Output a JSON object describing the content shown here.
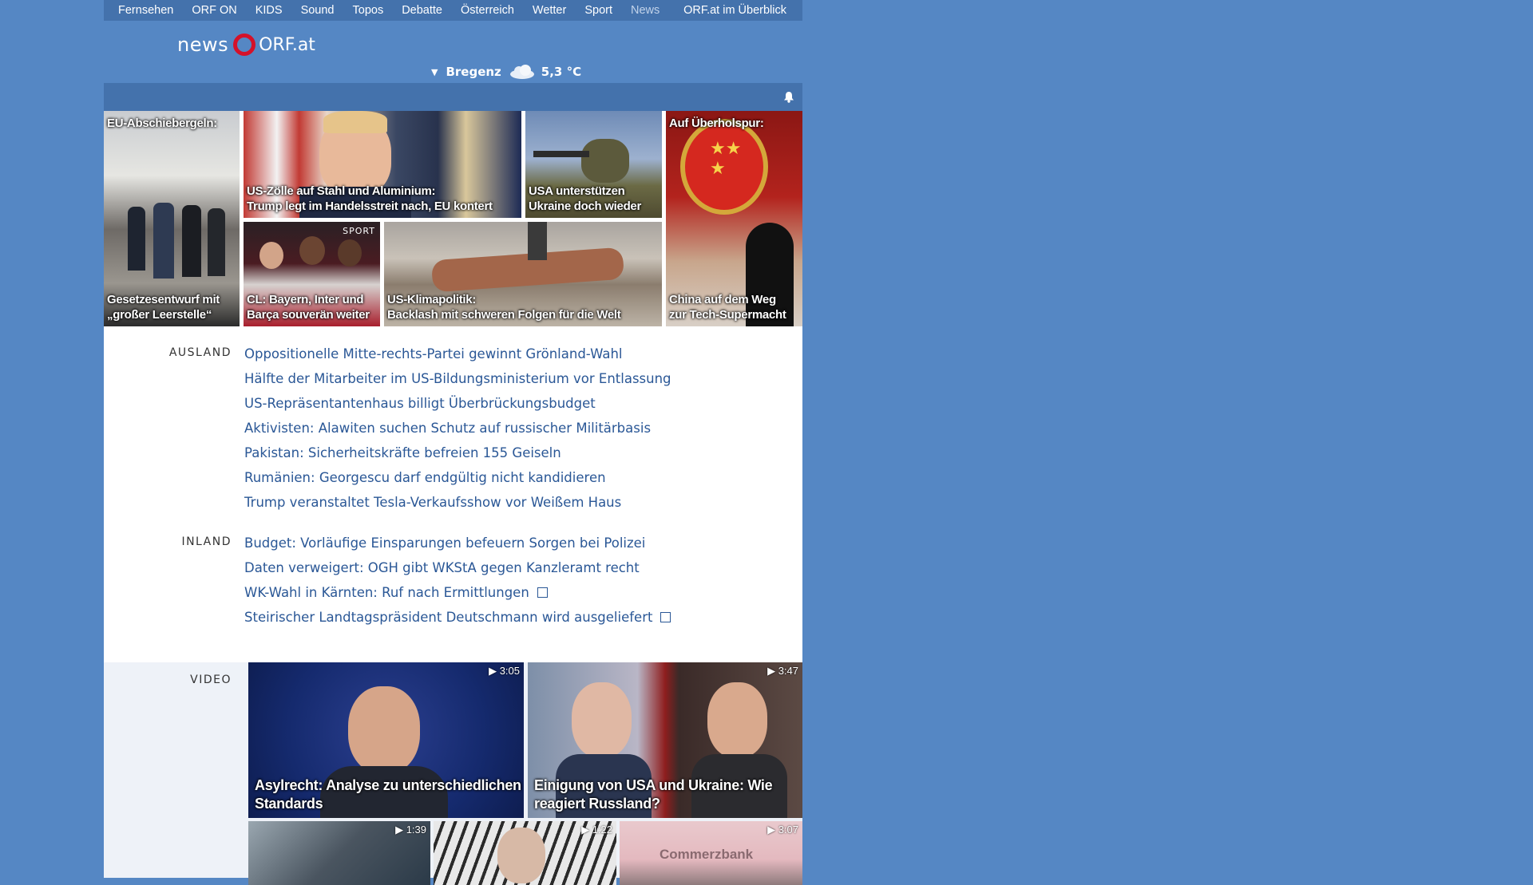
{
  "topnav": {
    "items": [
      "Fernsehen",
      "ORF ON",
      "KIDS",
      "Sound",
      "Topos",
      "Debatte",
      "Österreich",
      "Wetter",
      "Sport",
      "News"
    ],
    "overview": "ORF.at im Überblick"
  },
  "header": {
    "logo_news": "news",
    "logo_orf": "ORF.at",
    "weather_location": "Bregenz",
    "weather_temp": "5,3 °C"
  },
  "hero": {
    "tiles": [
      {
        "top": "EU-Abschiebergeln:",
        "bottom_line1": "Gesetzesentwurf mit",
        "bottom_line2": "„großer Leerstelle“"
      },
      {
        "line1": "US-Zölle auf Stahl und Aluminium:",
        "line2": "Trump legt im Handelsstreit nach, EU kontert"
      },
      {
        "line1": "USA unterstützen",
        "line2": "Ukraine doch wieder"
      },
      {
        "top": "Auf Überholspur:",
        "bottom_line1": "China auf dem Weg",
        "bottom_line2": "zur Tech-Supermacht"
      },
      {
        "badge": "SPORT",
        "line1": "CL: Bayern, Inter und",
        "line2": "Barça souverän weiter"
      },
      {
        "line1": "US-Klimapolitik:",
        "line2": "Backlash mit schweren Folgen für die Welt"
      }
    ]
  },
  "ausland": {
    "label": "AUSLAND",
    "items": [
      "Oppositionelle Mitte-rechts-Partei gewinnt Grönland-Wahl",
      "Hälfte der Mitarbeiter im US-Bildungsministerium vor Entlassung",
      "US-Repräsentantenhaus billigt Überbrückungsbudget",
      "Aktivisten: Alawiten suchen Schutz auf russischer Militärbasis",
      "Pakistan: Sicherheitskräfte befreien 155 Geiseln",
      "Rumänien: Georgescu darf endgültig nicht kandidieren",
      "Trump veranstaltet Tesla-Verkaufsshow vor Weißem Haus"
    ]
  },
  "inland": {
    "label": "INLAND",
    "items": [
      "Budget: Vorläufige Einsparungen befeuern Sorgen bei Polizei",
      "Daten verweigert: OGH gibt WKStA gegen Kanzleramt recht",
      "WK-Wahl in Kärnten: Ruf nach Ermittlungen",
      "Steirischer Landtagspräsident Deutschmann wird ausgeliefert"
    ]
  },
  "video": {
    "label": "VIDEO",
    "items": [
      {
        "duration": "▶ 3:05",
        "title_line1": "Asylrecht: Analyse zu unterschiedlichen",
        "title_line2": "Standards"
      },
      {
        "duration": "▶ 3:47",
        "title_line1": "Einigung von USA und Ukraine: Wie",
        "title_line2": "reagiert Russland?"
      },
      {
        "duration": "▶ 1:39"
      },
      {
        "duration": "▶ 1:22"
      },
      {
        "duration": "▶ 3:07",
        "sign": "Commerzbank"
      }
    ]
  },
  "colors": {
    "page_bg": "#5587c4",
    "nav_bg": "#4472ac",
    "link": "#2a5796",
    "orf_red": "#d4112a"
  }
}
